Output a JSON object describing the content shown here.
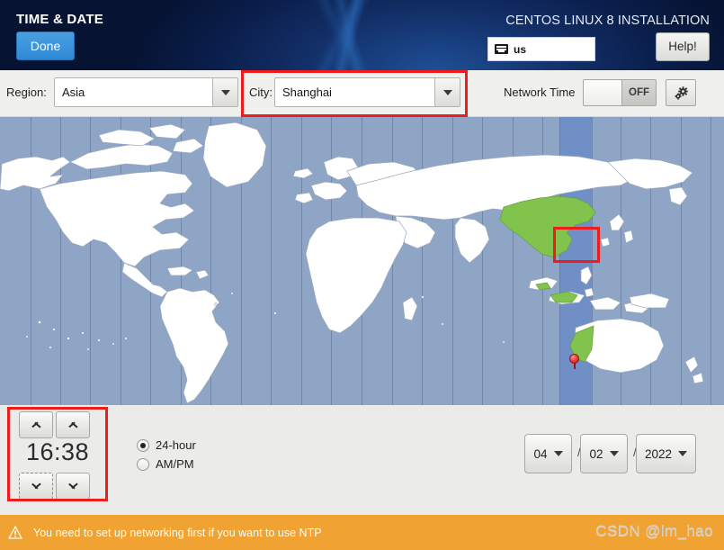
{
  "header": {
    "screen_title": "TIME & DATE",
    "done_label": "Done",
    "product_title": "CENTOS LINUX 8 INSTALLATION",
    "keyboard_layout": "us",
    "keyboard_icon": "keyboard-icon",
    "help_label": "Help!"
  },
  "toolbar": {
    "region_label": "Region:",
    "region_value": "Asia",
    "city_label": "City:",
    "city_value": "Shanghai",
    "network_time_label": "Network Time",
    "network_time_state": "OFF",
    "settings_icon": "gear-icon",
    "dropdown_icon": "chevron-down-icon"
  },
  "map": {
    "marker_icon": "location-pin-icon",
    "selected_timezone_label": "Asia/Shanghai",
    "ocean_color": "#8fa5c6",
    "land_color": "#ffffff",
    "highlight_color": "#82c34e",
    "selected_band_color": "#6f8fc6"
  },
  "time": {
    "display": "16:38",
    "hour": "16",
    "minute": "38",
    "hour_up_icon": "chevron-up-icon",
    "hour_down_icon": "chevron-down-icon",
    "minute_up_icon": "chevron-up-icon",
    "minute_down_icon": "chevron-down-icon",
    "format_options": [
      {
        "label": "24-hour",
        "selected": true
      },
      {
        "label": "AM/PM",
        "selected": false
      }
    ]
  },
  "date": {
    "month": "04",
    "day": "02",
    "year": "2022",
    "separator": "/",
    "dropdown_icon": "caret-down-icon"
  },
  "status": {
    "warning_icon": "warning-triangle-icon",
    "message": "You need to set up networking first if you want to use NTP",
    "background_color": "#f0a232"
  },
  "watermark": {
    "text": "CSDN @lm_hao"
  },
  "annotations": {
    "highlight_color": "#ee1c1c",
    "boxes": [
      "city-field-highlight",
      "map-marker-highlight",
      "time-spinner-highlight"
    ]
  }
}
